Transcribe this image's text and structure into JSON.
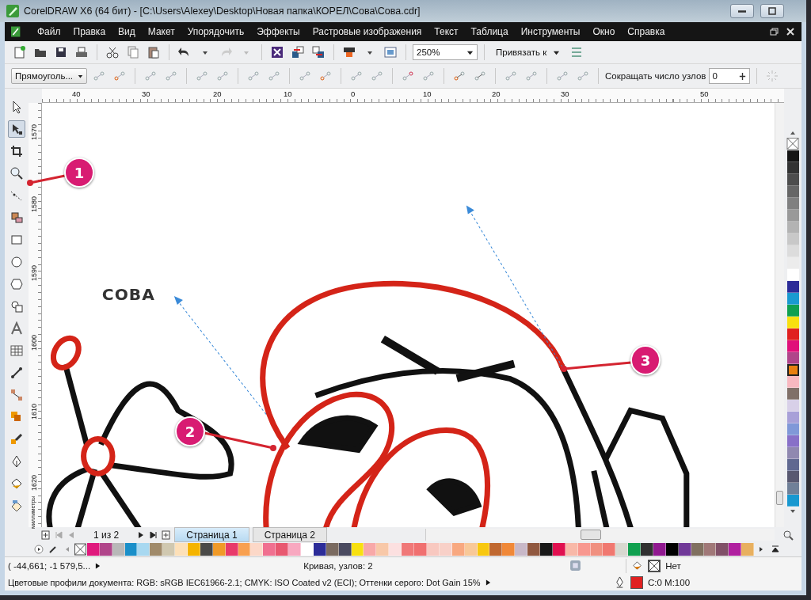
{
  "window": {
    "title": "CorelDRAW X6 (64 бит) - [C:\\Users\\Alexey\\Desktop\\Новая папка\\КОРЕЛ\\Сова\\Сова.cdr]"
  },
  "menu": [
    "Файл",
    "Правка",
    "Вид",
    "Макет",
    "Упорядочить",
    "Эффекты",
    "Растровые изображения",
    "Текст",
    "Таблица",
    "Инструменты",
    "Окно",
    "Справка"
  ],
  "toolbar": {
    "zoom": "250%",
    "snap": "Привязать к"
  },
  "property_bar": {
    "object_type": "Прямоуголь...",
    "reduce_nodes_label": "Сокращать число узлов",
    "reduce_nodes_value": "0"
  },
  "tools": [
    {
      "kind": "pick",
      "selected": false
    },
    {
      "kind": "shape",
      "selected": true
    },
    {
      "kind": "crop",
      "selected": false
    },
    {
      "kind": "zoom",
      "selected": false
    },
    {
      "kind": "freehand",
      "selected": false
    },
    {
      "kind": "smartfill",
      "selected": false
    },
    {
      "kind": "rectangle",
      "selected": false
    },
    {
      "kind": "ellipse",
      "selected": false
    },
    {
      "kind": "polygon",
      "selected": false
    },
    {
      "kind": "shapes",
      "selected": false
    },
    {
      "kind": "text",
      "selected": false
    },
    {
      "kind": "table",
      "selected": false
    },
    {
      "kind": "dimension",
      "selected": false
    },
    {
      "kind": "connector",
      "selected": false
    },
    {
      "kind": "blend",
      "selected": false
    },
    {
      "kind": "eyedropper",
      "selected": false
    },
    {
      "kind": "outline",
      "selected": false
    },
    {
      "kind": "fill",
      "selected": false
    },
    {
      "kind": "meshfill",
      "selected": false
    }
  ],
  "ruler": {
    "horizontal": [
      "40",
      "30",
      "20",
      "10",
      "0",
      "10",
      "20",
      "30",
      "50"
    ],
    "vertical": [
      "1570",
      "1580",
      "1590",
      "1600",
      "1610",
      "1620"
    ],
    "unit": "миллиметры"
  },
  "canvas": {
    "text": "СОВА"
  },
  "callouts": [
    {
      "number": "1"
    },
    {
      "number": "2"
    },
    {
      "number": "3"
    }
  ],
  "page_nav": {
    "counter": "1 из 2",
    "tabs": [
      {
        "label": "Страница 1",
        "selected": true
      },
      {
        "label": "Страница 2",
        "selected": false
      }
    ]
  },
  "palette_bottom": [
    {
      "color": "#e0197d"
    },
    {
      "color": "#b0458a"
    },
    {
      "color": "#b8b8b8"
    },
    {
      "color": "#1a8fc9"
    },
    {
      "color": "#a8d8f0"
    },
    {
      "color": "#a08a6a"
    },
    {
      "color": "#d0c8b0"
    },
    {
      "color": "#fde0b8"
    },
    {
      "color": "#f5b400"
    },
    {
      "color": "#4a4a48"
    },
    {
      "color": "#f09a28"
    },
    {
      "color": "#e83a6a"
    },
    {
      "color": "#f8a050"
    },
    {
      "color": "#fcd8c8"
    },
    {
      "color": "#f07090"
    },
    {
      "color": "#e85870"
    },
    {
      "color": "#f8a8c0"
    },
    {
      "color": "#ffffff"
    },
    {
      "color": "#2c2c98"
    },
    {
      "color": "#7a6a60"
    },
    {
      "color": "#4a4a60"
    },
    {
      "color": "#f8e010"
    },
    {
      "color": "#f8a8a8"
    },
    {
      "color": "#f8c8a8"
    },
    {
      "color": "#fce0e0"
    },
    {
      "color": "#f07878"
    },
    {
      "color": "#f07070"
    },
    {
      "color": "#f8c8c0"
    },
    {
      "color": "#f8d0c8"
    },
    {
      "color": "#f8a880"
    },
    {
      "color": "#f8c898"
    },
    {
      "color": "#f8c810"
    },
    {
      "color": "#c06830"
    },
    {
      "color": "#f08838"
    },
    {
      "color": "#c8b8c8"
    },
    {
      "color": "#905840"
    },
    {
      "color": "#181818"
    },
    {
      "color": "#e01050"
    },
    {
      "color": "#f8b8a8"
    },
    {
      "color": "#f89890"
    },
    {
      "color": "#f09080"
    },
    {
      "color": "#f07870"
    },
    {
      "color": "#d8d8d0"
    },
    {
      "color": "#10a050"
    },
    {
      "color": "#303030"
    },
    {
      "color": "#901890"
    },
    {
      "color": "#000000"
    },
    {
      "color": "#703898"
    },
    {
      "color": "#807060"
    },
    {
      "color": "#a07878"
    },
    {
      "color": "#805068"
    },
    {
      "color": "#b020a0"
    },
    {
      "color": "#e8b060"
    }
  ],
  "palette_right": [
    {
      "color": "#151515",
      "selected": false
    },
    {
      "color": "#333333",
      "selected": false
    },
    {
      "color": "#4d4d4d",
      "selected": false
    },
    {
      "color": "#666666",
      "selected": false
    },
    {
      "color": "#808080",
      "selected": false
    },
    {
      "color": "#999999",
      "selected": false
    },
    {
      "color": "#b3b3b3",
      "selected": false
    },
    {
      "color": "#c8c8c8",
      "selected": false
    },
    {
      "color": "#dcdcdc",
      "selected": false
    },
    {
      "color": "#ececec",
      "selected": false
    },
    {
      "color": "#ffffff",
      "selected": false
    },
    {
      "color": "#2c2c98",
      "selected": false
    },
    {
      "color": "#1a9ad0",
      "selected": false
    },
    {
      "color": "#10a050",
      "selected": false
    },
    {
      "color": "#f8e010",
      "selected": false
    },
    {
      "color": "#e02020",
      "selected": false
    },
    {
      "color": "#e0107a",
      "selected": false
    },
    {
      "color": "#b0458a",
      "selected": false
    },
    {
      "color": "#e88010",
      "selected": true
    },
    {
      "color": "#f8b8c0",
      "selected": false
    },
    {
      "color": "#807068",
      "selected": false
    },
    {
      "color": "#d8d0e8",
      "selected": false
    },
    {
      "color": "#a8a0d8",
      "selected": false
    },
    {
      "color": "#8098d8",
      "selected": false
    },
    {
      "color": "#8870c8",
      "selected": false
    },
    {
      "color": "#9088b0",
      "selected": false
    },
    {
      "color": "#606890",
      "selected": false
    },
    {
      "color": "#585870",
      "selected": false
    },
    {
      "color": "#708098",
      "selected": false
    },
    {
      "color": "#1898d0",
      "selected": false
    }
  ],
  "status_bar": {
    "coordinates": "( -44,661; -1 579,5...",
    "object_info": "Кривая, узлов: 2",
    "color_profiles": "Цветовые профили документа: RGB: sRGB IEC61966-2.1; CMYK: ISO Coated v2 (ECI); Оттенки серого: Dot Gain 15%",
    "fill": "Нет",
    "outline": "C:0 M:100"
  }
}
